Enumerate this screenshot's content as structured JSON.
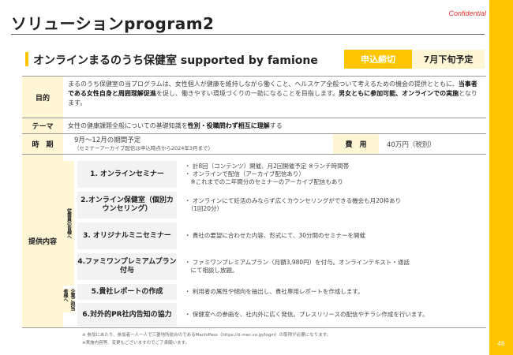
{
  "header": {
    "title": "ソリューションprogram2",
    "confidential": "Confidential"
  },
  "section": {
    "title": "オンラインまるのうち保健室 supported by famione",
    "apply_label": "申込締切",
    "apply_date": "7月下旬予定"
  },
  "purpose": {
    "label": "目的",
    "text_pre": "まるのうち保健室の当プログラムは、女性個人が健康を維持しながら働くこと、ヘルスケア全般ついて考えるための機会の提供とともに、",
    "text_bold1": "当事者である女性自身と周囲理解促進",
    "text_mid": "を促し、働きやすい環境づくりの一助になることを目指します。",
    "text_bold2": "男女ともに参加可能、オンラインでの実施",
    "text_post": "となります。"
  },
  "theme": {
    "label": "テーマ",
    "text_pre": "女性の健康課題全般についての基礎知識を",
    "text_bold": "性別・役職問わず相互に理解",
    "text_post": "する"
  },
  "period": {
    "label": "時　期",
    "text": "9月～12月の期間予定",
    "note": "（セミナーアーカイブ配信は申込時点から2024年3月まで）",
    "fee_label": "費　用",
    "fee_value": "40万円（税別）"
  },
  "offer": {
    "label": "提供内容",
    "group_a": "従業員の皆様へ",
    "group_b": "企業ご担当者様へ",
    "items": [
      {
        "title": "1. オンラインセミナー",
        "lines": [
          "・ 計8回（コンテンツ）開催、月2回開催予定 ※ランチ時間帯",
          "・ オンラインで配信（アーカイブ配信あり）",
          "　※これまでの二年間分のセミナーのアーカイブ配信もあり"
        ]
      },
      {
        "title": "2.オンライン保健室（個別カウンセリング）",
        "lines": [
          "・ オンラインにて妊活のみならず広くカウンセリングができる機会も月20枠あり",
          "　（1回20分）"
        ]
      },
      {
        "title": "3. オリジナルミニセミナー",
        "lines": [
          "・ 貴社の要望に合わせた内容、形式にて、30分間のセミナーを開催"
        ]
      },
      {
        "title": "4.ファミワンプレミアムプラン付与",
        "lines": [
          "・ ファミワンプレミアムプラン（月額3,980円）を付与。オンラインテキスト・通話",
          "　にて相談し放題。"
        ]
      },
      {
        "title": "5.貴社レポートの作成",
        "lines": [
          "・ 利用者の属性や傾向を抽出し、貴社専用レポートを作成します。"
        ]
      },
      {
        "title": "6.対外的PR社内告知の協力",
        "lines": [
          "・ 保健室への参画を、社内外に広く発信。プレスリリースの配信やチラシ作成を行います。"
        ]
      }
    ]
  },
  "footnotes": [
    "※ 参加にあたり、参加者一人一人で三菱地所総合のであるMachiPass（https://d.mec.co.jp/login）の取得が必要になります。",
    "※実施内容等、変更もございますのでご了承願います。"
  ],
  "page_number": "46",
  "colors": {
    "accent": "#FFC600",
    "label_bg": "#FFF6D5",
    "item_bg": "#F2F2F2",
    "confidential": "#E5322D"
  }
}
